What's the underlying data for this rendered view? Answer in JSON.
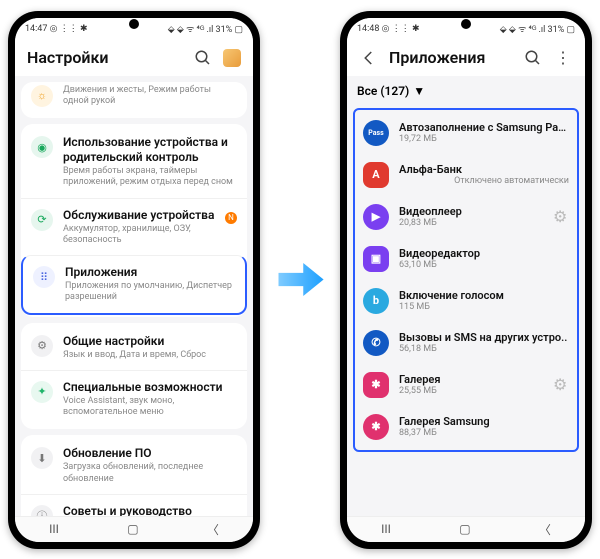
{
  "left": {
    "statusbar": {
      "time": "14:47",
      "left_icons": "◎ ⋮⋮ ✱",
      "right_icons": "⬙ ⬙ ᯤ ⁴ᴳ .ıl 31% ▢"
    },
    "header": {
      "title": "Настройки"
    },
    "rows": {
      "row0": {
        "title": "",
        "sub": "Движения и жесты, Режим работы одной рукой"
      },
      "row1": {
        "title": "Использование устройства и родительский контроль",
        "sub": "Время работы экрана, таймеры приложений, режим отдыха перед сном"
      },
      "row2": {
        "title": "Обслуживание устройства",
        "sub": "Аккумулятор, хранилище, ОЗУ, безопасность",
        "badge": "N"
      },
      "row3": {
        "title": "Приложения",
        "sub": "Приложения по умолчанию, Диспетчер разрешений"
      },
      "row4": {
        "title": "Общие настройки",
        "sub": "Язык и ввод, Дата и время, Сброс"
      },
      "row5": {
        "title": "Специальные возможности",
        "sub": "Voice Assistant, звук моно, вспомогательное меню"
      },
      "row6": {
        "title": "Обновление ПО",
        "sub": "Загрузка обновлений, последнее обновление"
      },
      "row7": {
        "title": "Советы и руководство",
        "sub": ""
      }
    }
  },
  "right": {
    "statusbar": {
      "time": "14:48",
      "left_icons": "◎ ⋮⋮ ✱",
      "right_icons": "⬙ ⬙ ᯤ ⁴ᴳ .ıl 31% ▢"
    },
    "header": {
      "title": "Приложения"
    },
    "filter": "Все (127)",
    "apps": {
      "a0": {
        "name": "Автозаполнение с Samsung Pas..",
        "sub": "19,72 МБ",
        "iconText": "Pass",
        "color": "#1259c3"
      },
      "a1": {
        "name": "Альфа-Банк",
        "sub": "",
        "extra": "Отключено автоматически",
        "iconText": "A",
        "color": "#e03a2f"
      },
      "a2": {
        "name": "Видеоплеер",
        "sub": "20,83 МБ",
        "gear": true,
        "iconText": "▶",
        "color": "#7a3ff0"
      },
      "a3": {
        "name": "Видеоредактор",
        "sub": "63,10 МБ",
        "iconText": "▣",
        "color": "#7a3ff0"
      },
      "a4": {
        "name": "Включение голосом",
        "sub": "115 МБ",
        "iconText": "b",
        "color": "#2aa9e0"
      },
      "a5": {
        "name": "Вызовы и SMS на других устро..",
        "sub": "56,18 МБ",
        "iconText": "✆",
        "color": "#1259c3"
      },
      "a6": {
        "name": "Галерея",
        "sub": "25,55 МБ",
        "gear": true,
        "iconText": "✱",
        "color": "#e0316e"
      },
      "a7": {
        "name": "Галерея Samsung",
        "sub": "88,37 МБ",
        "iconText": "✱",
        "color": "#e0316e"
      }
    }
  }
}
